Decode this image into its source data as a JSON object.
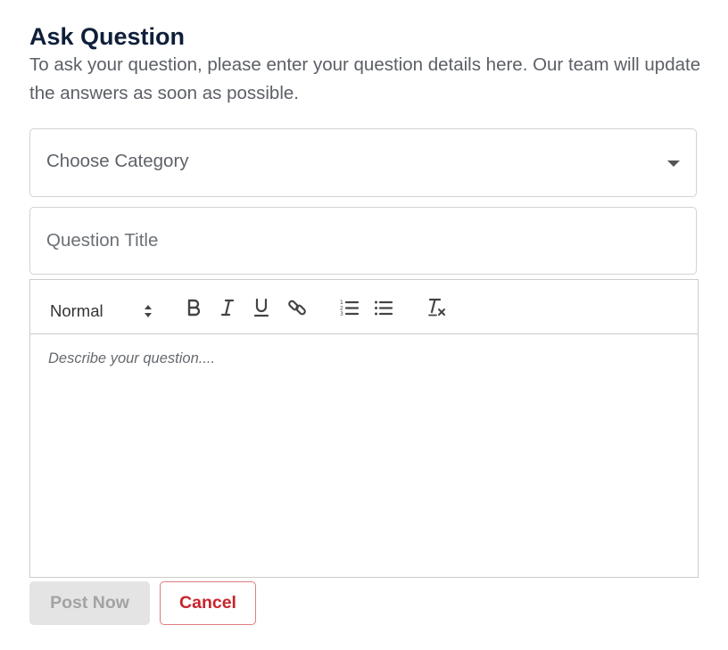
{
  "form": {
    "title": "Ask Question",
    "subtitle": "To ask your question, please enter your question details here. Our team will update the answers as soon as possible."
  },
  "category_select": {
    "selected": "Choose Category",
    "caret_icon": "caret-down-icon"
  },
  "question_title": {
    "value": "",
    "placeholder": "Question Title"
  },
  "editor": {
    "format_picker": {
      "selected": "Normal",
      "icon": "up-down-arrows-icon"
    },
    "toolbar_icons": [
      "bold-icon",
      "italic-icon",
      "underline-icon",
      "link-icon",
      "ordered-list-icon",
      "bullet-list-icon",
      "clear-format-icon"
    ],
    "placeholder": "Describe your question...."
  },
  "actions": {
    "post_label": "Post Now",
    "post_enabled": false,
    "cancel_label": "Cancel"
  },
  "colors": {
    "title": "#0f1f3a",
    "cancel_text": "#c8242b",
    "cancel_border": "#dd7d80",
    "disabled_bg": "#e4e4e4",
    "disabled_text": "#a3a3a3"
  }
}
